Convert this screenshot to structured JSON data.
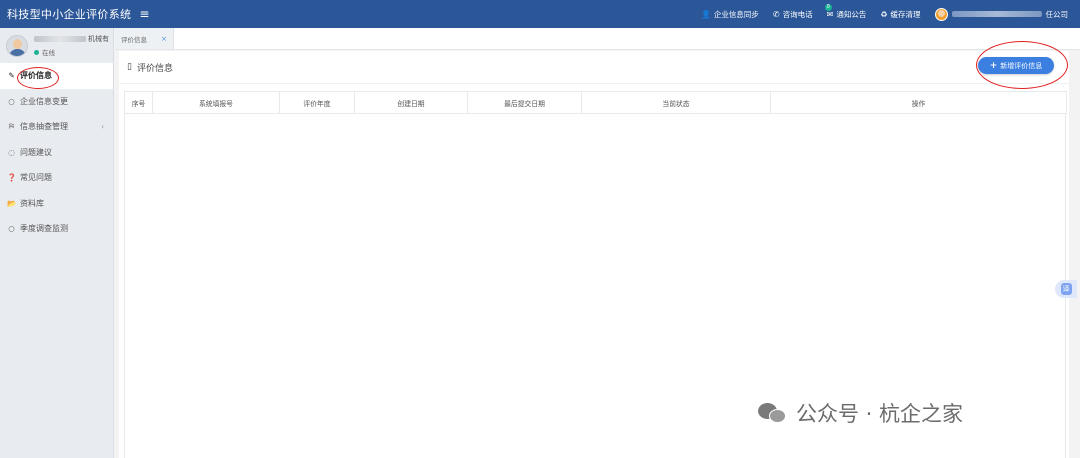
{
  "topbar": {
    "title": "科技型中小企业评价系统",
    "menu_icon": "≡",
    "items": [
      {
        "icon": "👤",
        "label": "企业信息同步"
      },
      {
        "icon": "✆",
        "label": "咨询电话"
      },
      {
        "icon": "✉",
        "label": "通知公告",
        "badge": "0"
      },
      {
        "icon": "♻",
        "label": "缓存清理"
      }
    ],
    "user_suffix": "任公司"
  },
  "sidebar": {
    "profile_name_suffix": "机械有",
    "status_text": "在线",
    "items": [
      {
        "icon": "✎",
        "label": "评价信息"
      },
      {
        "icon": "○",
        "label": "企业信息变更"
      },
      {
        "icon": "⛿",
        "label": "信息抽查管理",
        "arrow": "‹"
      },
      {
        "icon": "◌",
        "label": "问题建议"
      },
      {
        "icon": "❓",
        "label": "常见问题"
      },
      {
        "icon": "📂",
        "label": "资料库"
      },
      {
        "icon": "○",
        "label": "季度调查监测"
      }
    ]
  },
  "tabs": [
    {
      "label": "评价信息",
      "close": "×"
    }
  ],
  "panel": {
    "title_icon": "▯",
    "title": "评价信息",
    "add_button_icon": "+",
    "add_button_label": "新增评价信息"
  },
  "table": {
    "columns": [
      "序号",
      "系统填报号",
      "评价年度",
      "创建日期",
      "最后提交日期",
      "当前状态",
      "操作"
    ]
  },
  "float_button": "译",
  "watermark": "公众号 · 杭企之家",
  "colors": {
    "topbar": "#2b5697",
    "accent_button": "#3b7fe0",
    "highlight": "#e02020",
    "status_online": "#1ab394"
  }
}
